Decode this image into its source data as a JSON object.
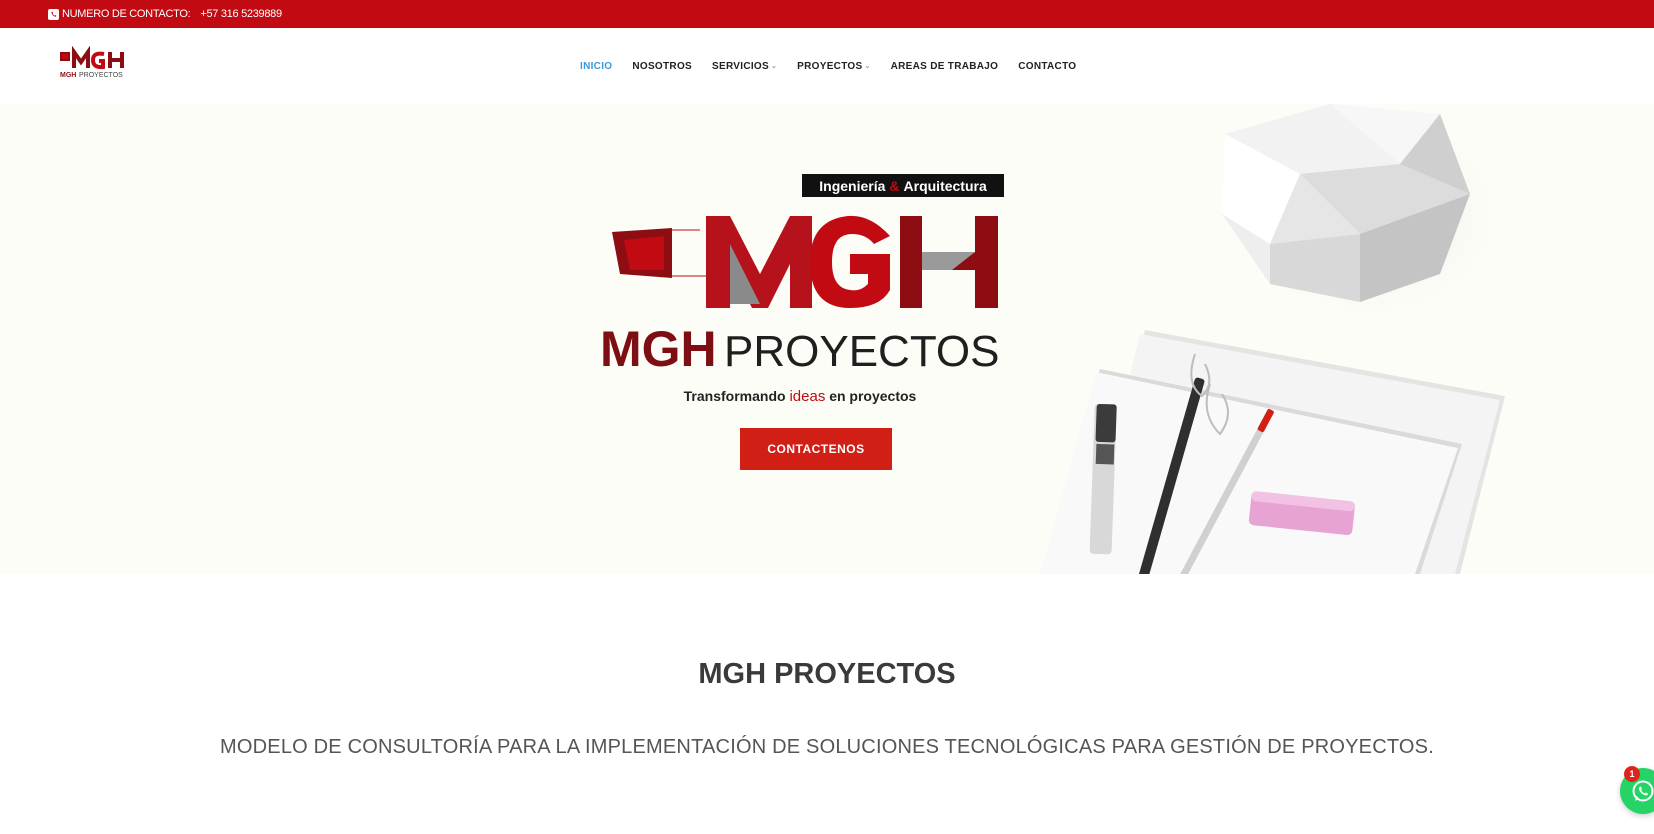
{
  "topbar": {
    "contact_label": "NUMERO DE CONTACTO:",
    "phone": "+57 316 5239889",
    "icon": "whatsapp-phone-icon"
  },
  "nav": {
    "items": [
      {
        "label": "INICIO",
        "active": true,
        "has_dropdown": false
      },
      {
        "label": "NOSOTROS",
        "active": false,
        "has_dropdown": false
      },
      {
        "label": "SERVICIOS",
        "active": false,
        "has_dropdown": true
      },
      {
        "label": "PROYECTOS",
        "active": false,
        "has_dropdown": true
      },
      {
        "label": "AREAS DE TRABAJO",
        "active": false,
        "has_dropdown": false
      },
      {
        "label": "CONTACTO",
        "active": false,
        "has_dropdown": false
      }
    ]
  },
  "hero": {
    "badge_left": "Ingeniería",
    "badge_amp": "&",
    "badge_right": "Arquitectura",
    "logo_text": "MGH",
    "brand_bold": "MGH",
    "brand_light": "PROYECTOS",
    "slogan_before": "Transformando",
    "slogan_highlight": "ideas",
    "slogan_after": "en proyectos",
    "cta_label": "CONTACTENOS"
  },
  "section": {
    "title": "MGH PROYECTOS",
    "subtitle": "MODELO DE CONSULTORÍA PARA LA IMPLEMENTACIÓN DE SOLUCIONES TECNOLÓGICAS PARA GESTIÓN DE PROYECTOS."
  },
  "whatsapp": {
    "badge_count": "1",
    "icon": "whatsapp-icon"
  },
  "colors": {
    "brand_red": "#c10a12",
    "cta_red": "#d21f16",
    "active_nav": "#3a9ad9",
    "whatsapp_green": "#25d366"
  }
}
